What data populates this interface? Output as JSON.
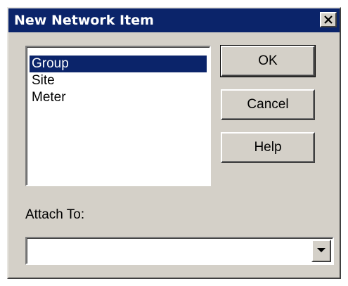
{
  "window": {
    "title": "New Network Item",
    "close_icon": "close-icon"
  },
  "listbox": {
    "items": [
      {
        "label": "Group",
        "selected": true
      },
      {
        "label": "Site",
        "selected": false
      },
      {
        "label": "Meter",
        "selected": false
      }
    ]
  },
  "buttons": {
    "ok_label": "OK",
    "cancel_label": "Cancel",
    "help_label": "Help"
  },
  "attach": {
    "label": "Attach To:",
    "value": "",
    "dropdown_icon": "chevron-down-icon"
  },
  "colors": {
    "titlebar": "#0b246a",
    "face": "#d4d0c8",
    "selection": "#0b246a"
  }
}
